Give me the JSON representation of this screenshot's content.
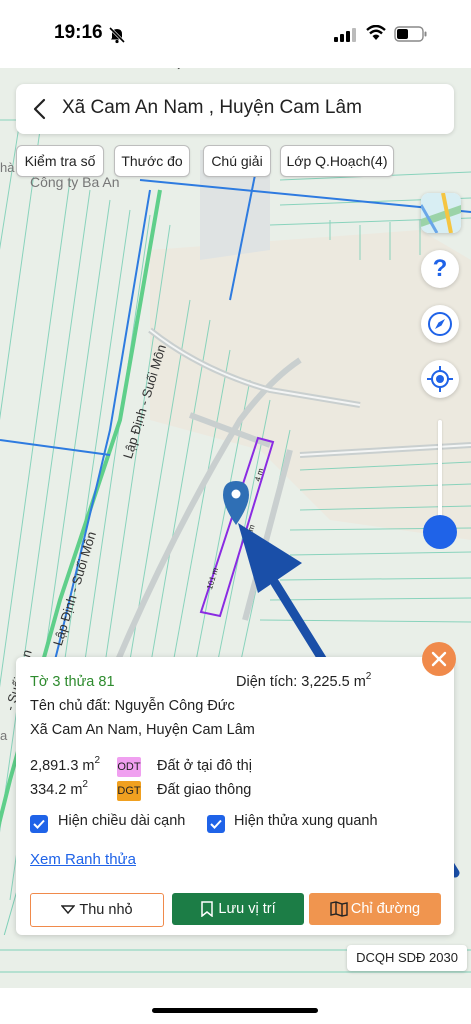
{
  "status": {
    "time": "19:16"
  },
  "header": {
    "title": "Xã Cam An Nam , Huyện Cam Lâm"
  },
  "toolbar": {
    "chips": [
      "Kiểm tra số",
      "Thước đo",
      "Chú giải",
      "Lớp Q.Hoạch(4)"
    ]
  },
  "map": {
    "labels": {
      "company": "Công ty Ba An",
      "river_upper": "Lập Định - Suối Môn",
      "river_lower": "Lập Định - Suối Môn",
      "river_corner": "- Suối Môn",
      "fragment_left": "hà",
      "fragment_left2": "a",
      "fragment_top": "Su",
      "edge_len_1": "101 m",
      "edge_len_2": "4 m",
      "edge_len_3": "m"
    },
    "colors": {
      "parcel_outline": "#8a2be2",
      "road_blue": "#2e7be0",
      "arrow": "#1a4fa8",
      "grid_line": "#66c7ad"
    }
  },
  "controls": {
    "help": "?"
  },
  "panel": {
    "parcel": "Tờ 3 thửa 81",
    "area_label": "Diện tích: 3,225.5",
    "area_unit": "m",
    "area_exp": "2",
    "owner": "Tên chủ đất: Nguyễn Công Đức",
    "address": "Xã Cam An Nam, Huyện Cam Lâm",
    "land_uses": [
      {
        "area": "2,891.3 m",
        "exp": "2",
        "code": "ODT",
        "color": "#f0a0f0",
        "name": "Đất ở tại đô thị"
      },
      {
        "area": "334.2 m",
        "exp": "2",
        "code": "DGT",
        "color": "#f0a020",
        "name": "Đất giao thông"
      }
    ],
    "checkbox_1": "Hiện chiều dài cạnh",
    "checkbox_2": "Hiện thửa xung quanh",
    "link": "Xem Ranh thửa",
    "buttons": {
      "collapse": "Thu nhỏ",
      "save": "Lưu vị trí",
      "directions": "Chỉ đường"
    }
  },
  "plan_badge": "DCQH SDĐ 2030"
}
